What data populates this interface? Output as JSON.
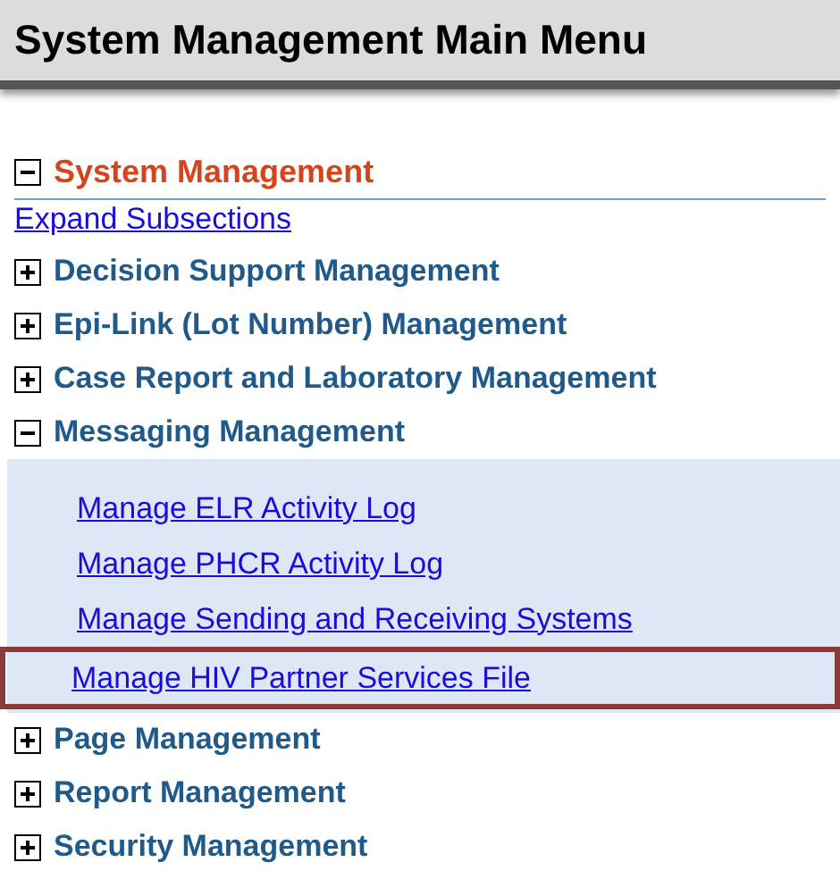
{
  "page_title": "System Management Main Menu",
  "section": {
    "title": "System Management",
    "expanded": true
  },
  "expand_link": "Expand Subsections",
  "subsections": [
    {
      "title": "Decision Support Management",
      "expanded": false
    },
    {
      "title": "Epi-Link (Lot Number) Management",
      "expanded": false
    },
    {
      "title": "Case Report and Laboratory Management",
      "expanded": false
    },
    {
      "title": "Messaging Management",
      "expanded": true,
      "links": [
        {
          "label": "Manage ELR Activity Log",
          "selected": false
        },
        {
          "label": "Manage PHCR Activity Log",
          "selected": false
        },
        {
          "label": "Manage Sending and Receiving Systems",
          "selected": false
        },
        {
          "label": "Manage HIV Partner Services File",
          "selected": true
        }
      ]
    },
    {
      "title": "Page Management",
      "expanded": false
    },
    {
      "title": "Report Management",
      "expanded": false
    },
    {
      "title": "Security Management",
      "expanded": false
    }
  ]
}
